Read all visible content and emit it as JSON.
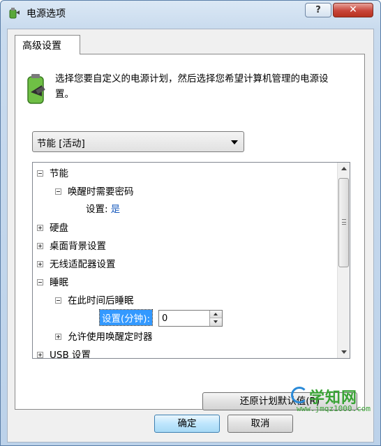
{
  "window": {
    "title": "电源选项",
    "help_label": "?",
    "close_label": "✕"
  },
  "tab": {
    "label": "高级设置"
  },
  "description": "选择您要自定义的电源计划，然后选择您希望计算机管理的电源设置。",
  "plan_select": {
    "value": "节能 [活动]"
  },
  "tree": {
    "items": [
      {
        "label": "节能"
      },
      {
        "label": "唤醒时需要密码"
      },
      {
        "label": "设置:",
        "value": "是"
      },
      {
        "label": "硬盘"
      },
      {
        "label": "桌面背景设置"
      },
      {
        "label": "无线适配器设置"
      },
      {
        "label": "睡眠"
      },
      {
        "label": "在此时间后睡眠"
      },
      {
        "label": "设置(分钟):",
        "value": "0"
      },
      {
        "label": "允许使用唤醒定时器"
      },
      {
        "label": "USB 设置"
      }
    ]
  },
  "buttons": {
    "restore": "还原计划默认值(R)",
    "ok": "确定",
    "cancel": "取消"
  },
  "watermark": {
    "main": "学知网",
    "url": "www.jmqz1000.com"
  },
  "colors": {
    "selection": "#3399ff",
    "value_text": "#1f5fbf",
    "watermark": "#3aa336"
  }
}
